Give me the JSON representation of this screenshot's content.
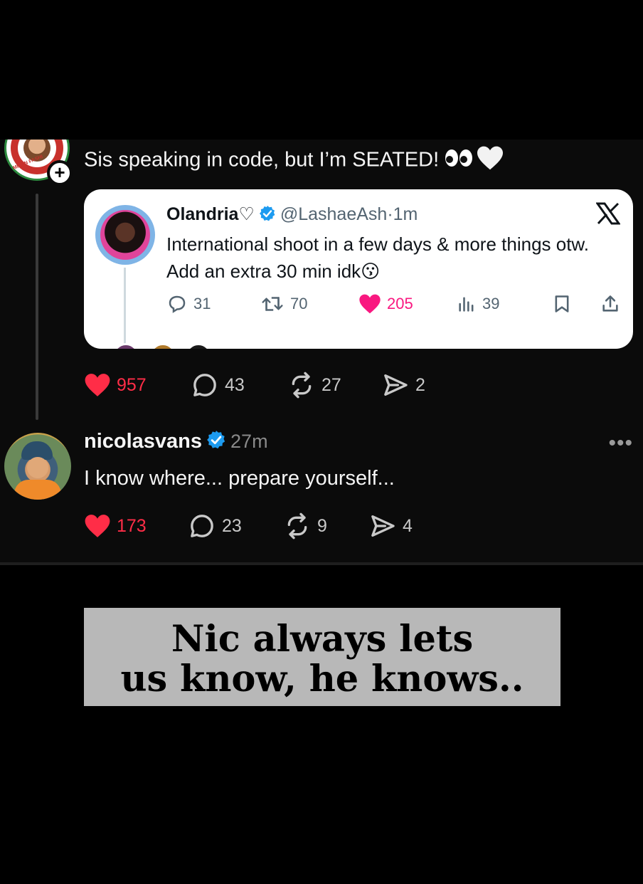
{
  "post1": {
    "text": "Sis speaking in code, but I’m SEATED!",
    "follow_symbol": "+",
    "avatar_caption": "MILAN FASHI",
    "actions": {
      "likes": "957",
      "replies": "43",
      "reposts": "27",
      "shares": "2"
    }
  },
  "quoted_post": {
    "name": "Olandria♡",
    "handle": "@LashaeAsh",
    "separator": "·",
    "time": "1m",
    "body_text": "International shoot in a few days & more things otw. Add an extra 30 min idk",
    "body_emoji": "😗",
    "stats": {
      "replies": "31",
      "reposts": "70",
      "likes": "205",
      "views": "39"
    },
    "platform_icon": "x-logo-icon"
  },
  "post2": {
    "username": "nicolasvans",
    "time": "27m",
    "text": "I know where... prepare yourself...",
    "more_label": "•••",
    "actions": {
      "likes": "173",
      "replies": "23",
      "reposts": "9",
      "shares": "4"
    }
  },
  "caption": {
    "line1": "Nic always lets",
    "line2": "us know, he knows.."
  },
  "colors": {
    "background": "#000000",
    "like_red": "#ff2d47",
    "card_like_pink": "#f91880",
    "verified_blue": "#1d9bf0",
    "caption_bg": "#b8b8b8"
  }
}
